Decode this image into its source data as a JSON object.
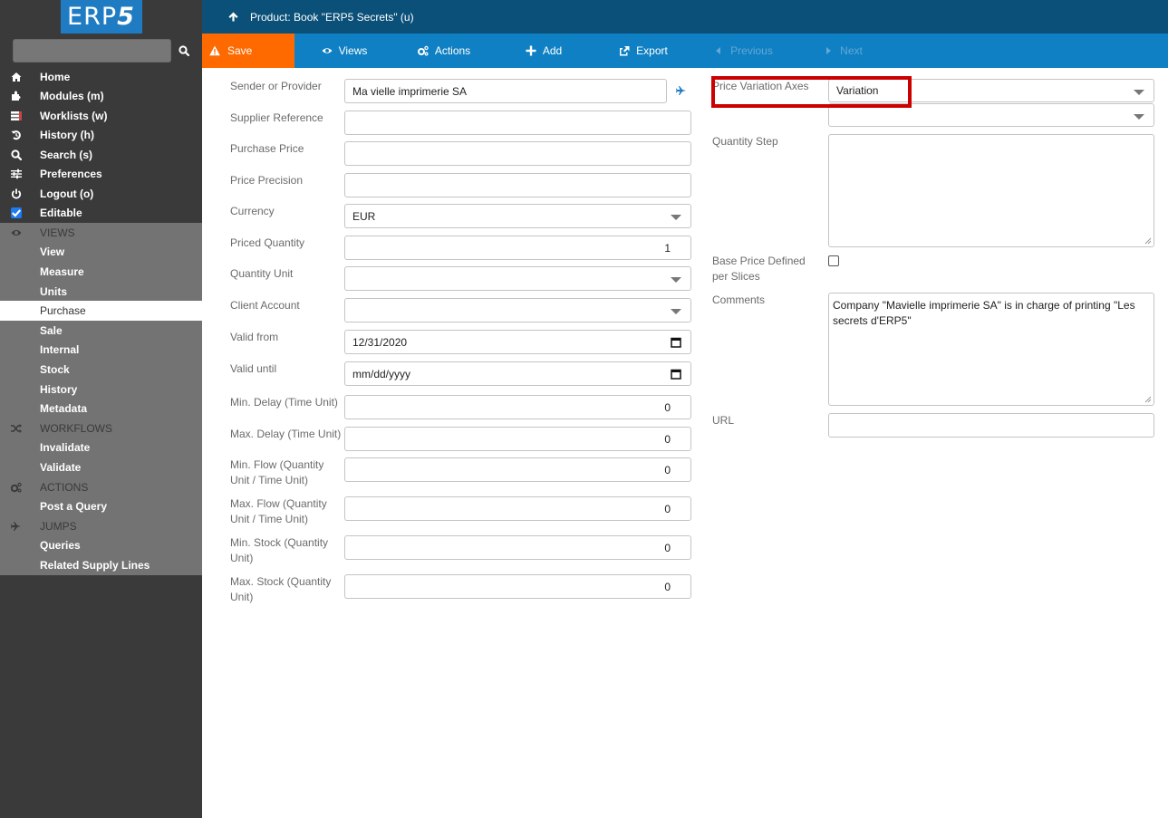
{
  "app": {
    "logo_text": "ERP",
    "logo_suffix": "5"
  },
  "colors": {
    "sidebar_bg": "#3a3a3a",
    "sidebar_section_bg": "#737373",
    "header_bg": "#0b5079",
    "navbar_bg": "#0f80c3",
    "save_bg": "#ff6a00",
    "logo_bg": "#1f7cc3",
    "highlight_border": "#cc0000"
  },
  "sidebar": {
    "search": {
      "value": "",
      "placeholder": ""
    },
    "main_items": [
      {
        "label": "Home",
        "icon": "home-icon"
      },
      {
        "label": "Modules (m)",
        "icon": "puzzle-icon"
      },
      {
        "label": "Worklists (w)",
        "icon": "tasks-icon"
      },
      {
        "label": "History (h)",
        "icon": "history-icon"
      },
      {
        "label": "Search (s)",
        "icon": "search-icon"
      },
      {
        "label": "Preferences",
        "icon": "sliders-icon"
      },
      {
        "label": "Logout (o)",
        "icon": "power-icon"
      },
      {
        "label": "Editable",
        "icon": "checkbox-checked-icon",
        "checked": true
      }
    ],
    "views": {
      "heading": "VIEWS",
      "items": [
        "View",
        "Measure",
        "Units",
        "Purchase",
        "Sale",
        "Internal",
        "Stock",
        "History",
        "Metadata"
      ],
      "active": "Purchase"
    },
    "workflows": {
      "heading": "WORKFLOWS",
      "items": [
        "Invalidate",
        "Validate"
      ]
    },
    "actions": {
      "heading": "ACTIONS",
      "items": [
        "Post a Query"
      ]
    },
    "jumps": {
      "heading": "JUMPS",
      "items": [
        "Queries",
        "Related Supply Lines"
      ]
    }
  },
  "header": {
    "title": "Product: Book \"ERP5 Secrets\" (u)"
  },
  "toolbar": {
    "save": "Save",
    "views": "Views",
    "actions": "Actions",
    "add": "Add",
    "export": "Export",
    "previous": "Previous",
    "next": "Next"
  },
  "form": {
    "left": {
      "sender_or_provider": {
        "label": "Sender or Provider",
        "value": "Ma vielle imprimerie SA"
      },
      "supplier_reference": {
        "label": "Supplier Reference",
        "value": ""
      },
      "purchase_price": {
        "label": "Purchase Price",
        "value": ""
      },
      "price_precision": {
        "label": "Price Precision",
        "value": ""
      },
      "currency": {
        "label": "Currency",
        "value": "EUR"
      },
      "priced_quantity": {
        "label": "Priced Quantity",
        "value": "1"
      },
      "quantity_unit": {
        "label": "Quantity Unit",
        "value": ""
      },
      "client_account": {
        "label": "Client Account",
        "value": ""
      },
      "valid_from": {
        "label": "Valid from",
        "value": "12/31/2020"
      },
      "valid_until": {
        "label": "Valid until",
        "value": "mm/dd/yyyy"
      },
      "min_delay": {
        "label": "Min. Delay (Time Unit)",
        "value": "0"
      },
      "max_delay": {
        "label": "Max. Delay (Time Unit)",
        "value": "0"
      },
      "min_flow": {
        "label": "Min. Flow (Quantity Unit / Time Unit)",
        "value": "0"
      },
      "max_flow": {
        "label": "Max. Flow (Quantity Unit / Time Unit)",
        "value": "0"
      },
      "min_stock": {
        "label": "Min. Stock (Quantity Unit)",
        "value": "0"
      },
      "max_stock": {
        "label": "Max. Stock (Quantity Unit)",
        "value": "0"
      }
    },
    "right": {
      "price_variation_axes": {
        "label": "Price Variation Axes",
        "value": "Variation",
        "value2": ""
      },
      "quantity_step": {
        "label": "Quantity Step",
        "value": ""
      },
      "base_price_per_slices": {
        "label": "Base Price Defined per Slices",
        "checked": false
      },
      "comments": {
        "label": "Comments",
        "value": "Company \"Mavielle imprimerie SA\" is in charge of printing \"Les secrets d'ERP5\""
      },
      "url": {
        "label": "URL",
        "value": ""
      }
    }
  }
}
